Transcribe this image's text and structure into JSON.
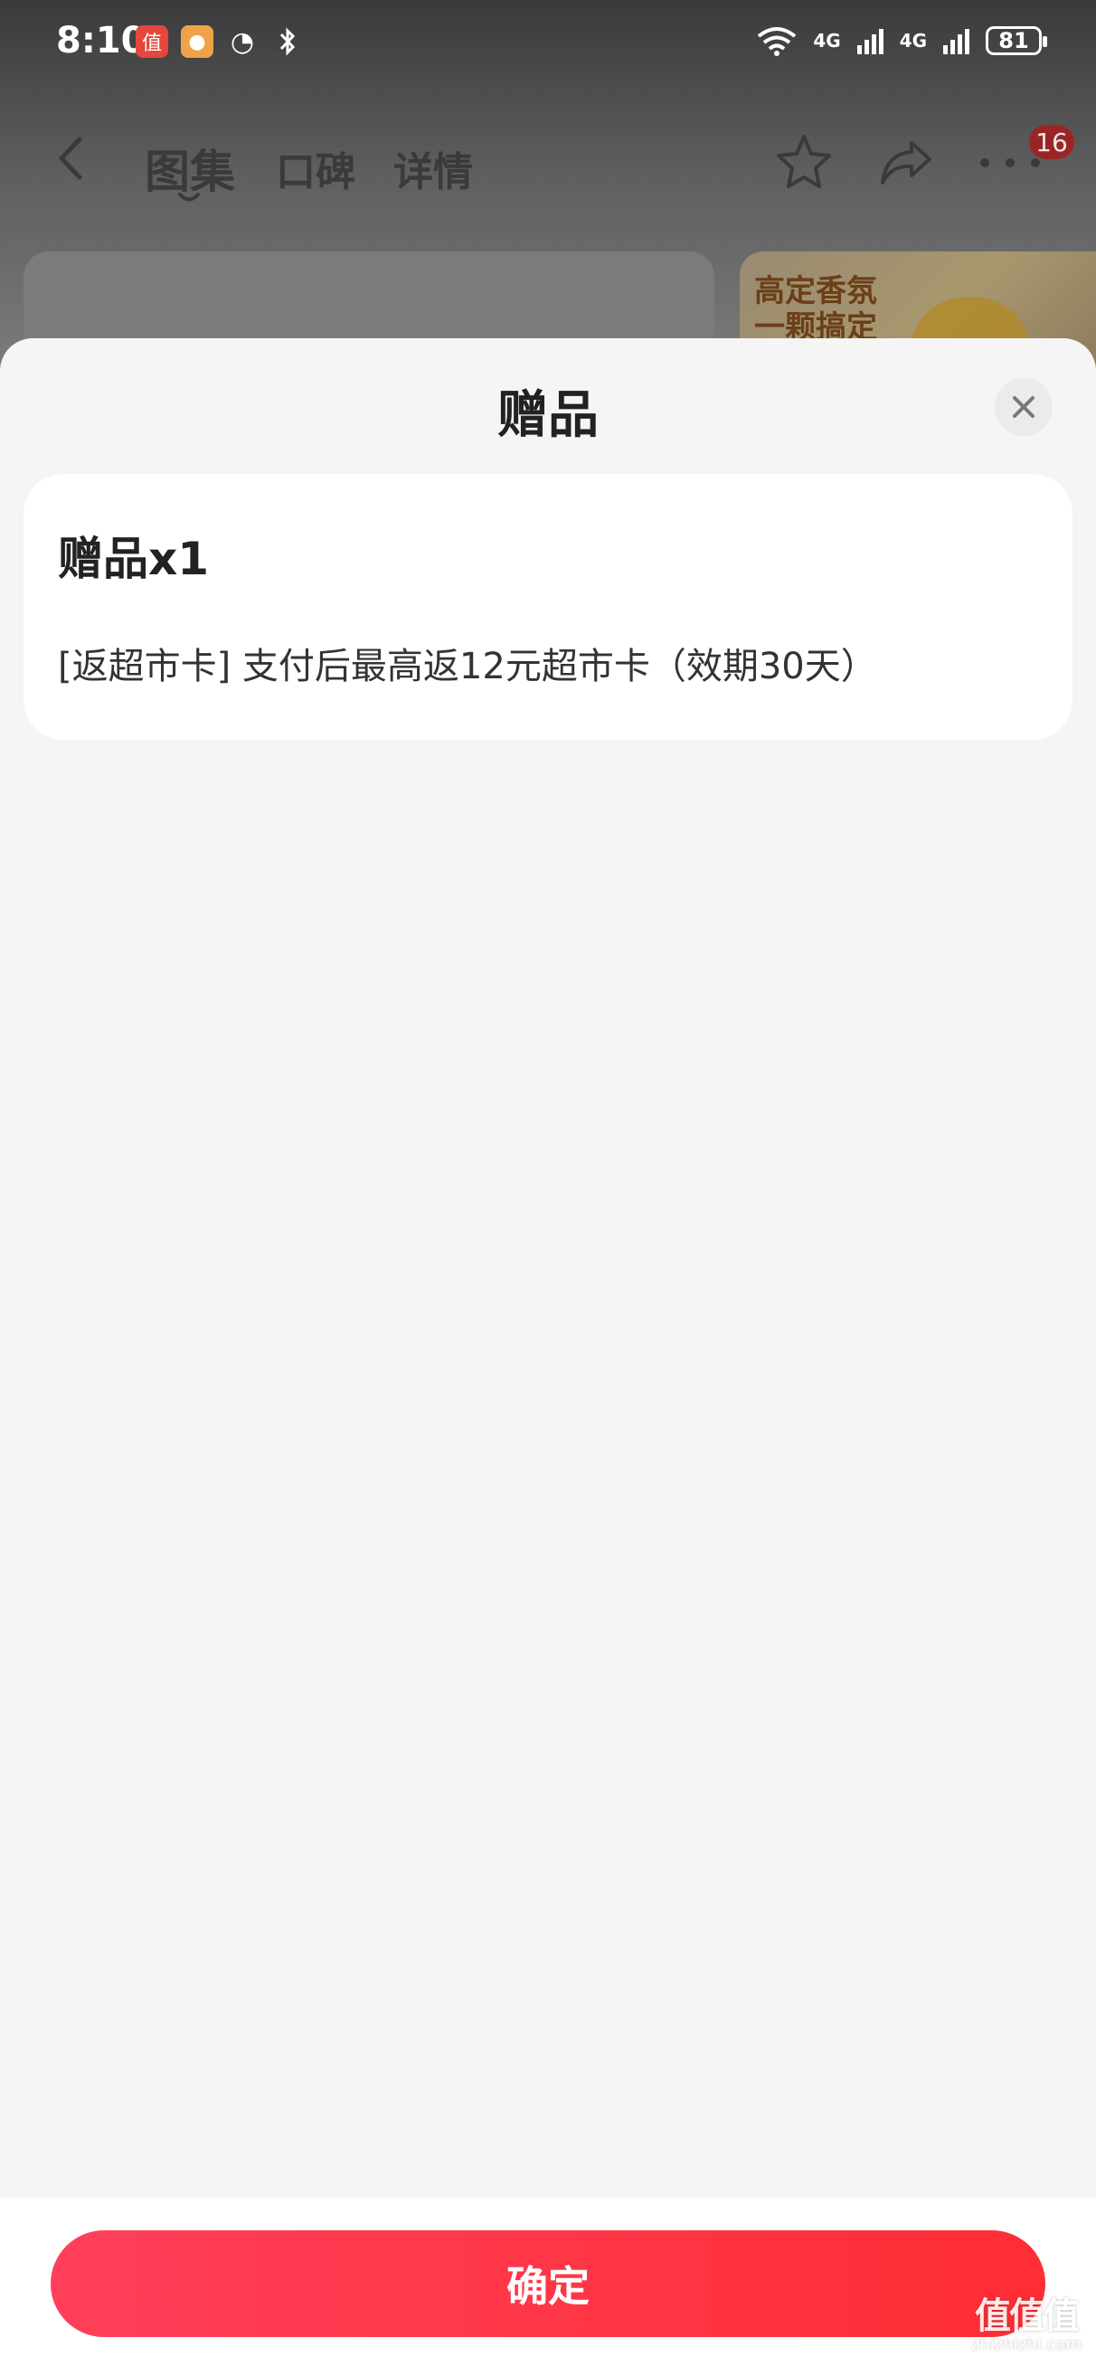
{
  "status_bar": {
    "time": "8:10",
    "battery": "81",
    "network_1": "4G",
    "network_2": "4G"
  },
  "nav": {
    "tabs": [
      {
        "label": "图集"
      },
      {
        "label": "口碑"
      },
      {
        "label": "详情"
      }
    ],
    "badge_count": "16"
  },
  "banner": {
    "line1": "高定香氛",
    "line2": "一颗搞定"
  },
  "sheet": {
    "title": "赠品",
    "gift_heading": "赠品x1",
    "gift_description": "[返超市卡] 支付后最高返12元超市卡（效期30天）"
  },
  "footer": {
    "confirm_label": "确定"
  },
  "watermark": {
    "main": "值值值",
    "sub": "zhizhizhi.com"
  },
  "colors": {
    "accent": "#ff2d34",
    "badge": "#9b2525",
    "sheet_bg": "#f5f5f5"
  },
  "icons": [
    "back-icon",
    "star-icon",
    "share-icon",
    "more-icon",
    "close-icon",
    "wifi-icon",
    "bluetooth-icon",
    "battery-icon"
  ]
}
